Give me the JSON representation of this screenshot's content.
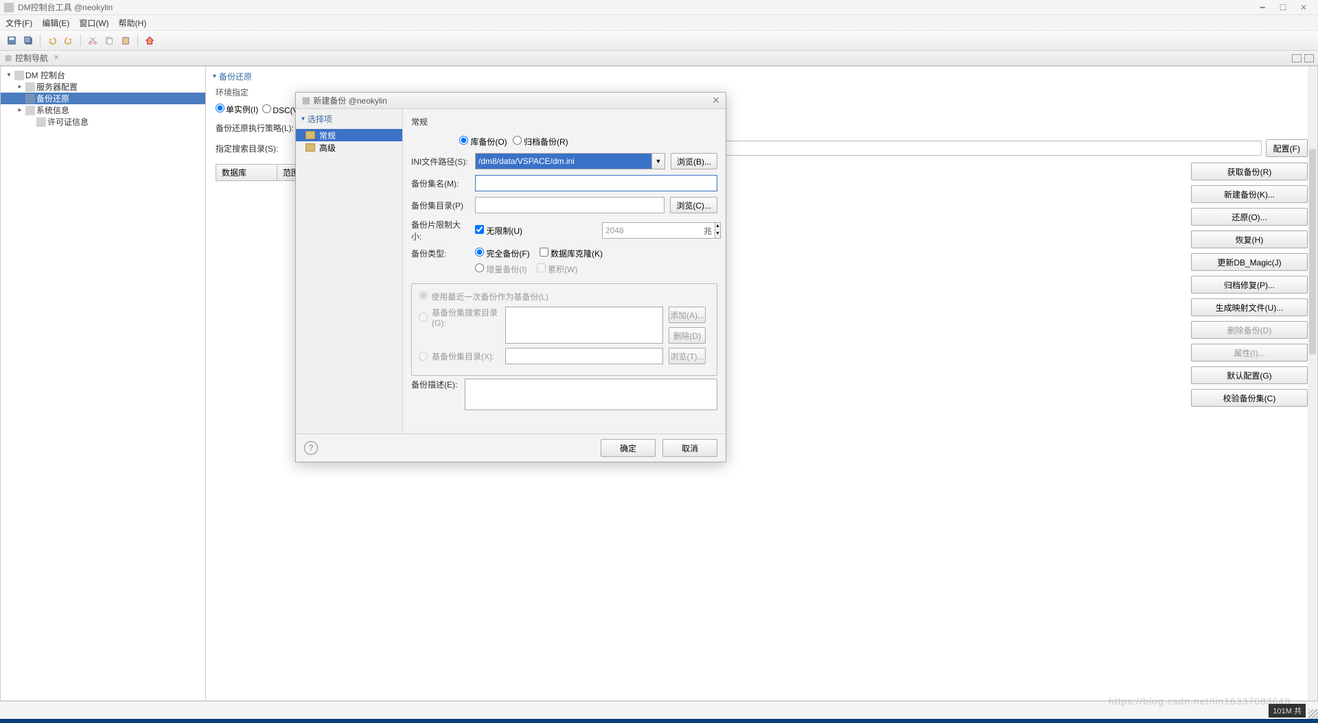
{
  "window": {
    "title": "DM控制台工具 @neokylin"
  },
  "menu": {
    "file": "文件(F)",
    "edit": "编辑(E)",
    "window": "窗口(W)",
    "help": "帮助(H)"
  },
  "view_tab": {
    "label": "控制导航",
    "close": "✕"
  },
  "tree": {
    "root": "DM 控制台",
    "svc": "服务器配置",
    "backup": "备份还原",
    "sysinfo": "系统信息",
    "license": "许可证信息"
  },
  "section": {
    "header": "备份还原",
    "env": "环境指定",
    "radio_single": "单实例(I)",
    "radio_dsc": "DSC(V)",
    "strategy_label": "备份还原执行策略(L):",
    "search_label": "指定搜索目录(S):",
    "cfg_btn": "配置(F)",
    "th_db": "数据库",
    "th_range": "范围"
  },
  "rbtns": {
    "b0": "获取备份(R)",
    "b1": "新建备份(K)...",
    "b2": "还原(O)...",
    "b3": "恢复(H)",
    "b4": "更新DB_Magic(J)",
    "b5": "归档修复(P)...",
    "b6": "生成映射文件(U)...",
    "b7": "删除备份(D)",
    "b8": "属性(I)...",
    "b9": "默认配置(G)",
    "b10": "校验备份集(C)"
  },
  "dialog": {
    "title": "新建备份  @neokylin",
    "left_head": "选择项",
    "left_general": "常规",
    "left_advanced": "高级",
    "panel_title": "常规",
    "radio_db_backup": "库备份(O)",
    "radio_arch_backup": "归档备份(R)",
    "ini_label": "INI文件路径(S):",
    "ini_value": "/dm8/data/VSPACE/dm.ini",
    "browse_b": "浏览(B)...",
    "set_name_label": "备份集名(M):",
    "set_dir_label": "备份集目录(P)",
    "browse_c": "浏览(C)...",
    "slice_label": "备份片限制大小:",
    "unlimited": "无限制(U)",
    "spin_value": "2048",
    "unit": "兆",
    "type_label": "备份类型:",
    "type_full": "完全备份(F)",
    "type_clone": "数据库克隆(K)",
    "type_incr": "增量备份(I)",
    "type_cumu": "累积(W)",
    "use_last": "使用最近一次备份作为基备份(L)",
    "base_search": "基备份集搜索目录(G):",
    "add": "添加(A)...",
    "del": "删除(D)",
    "base_dir": "基备份集目录(X):",
    "browse_t": "浏览(T)...",
    "desc_label": "备份描述(E):",
    "ok": "确定",
    "cancel": "取消"
  },
  "status": {
    "mem": "101M 共"
  },
  "watermark": "https://blog.csdn.net/lin16337083648"
}
